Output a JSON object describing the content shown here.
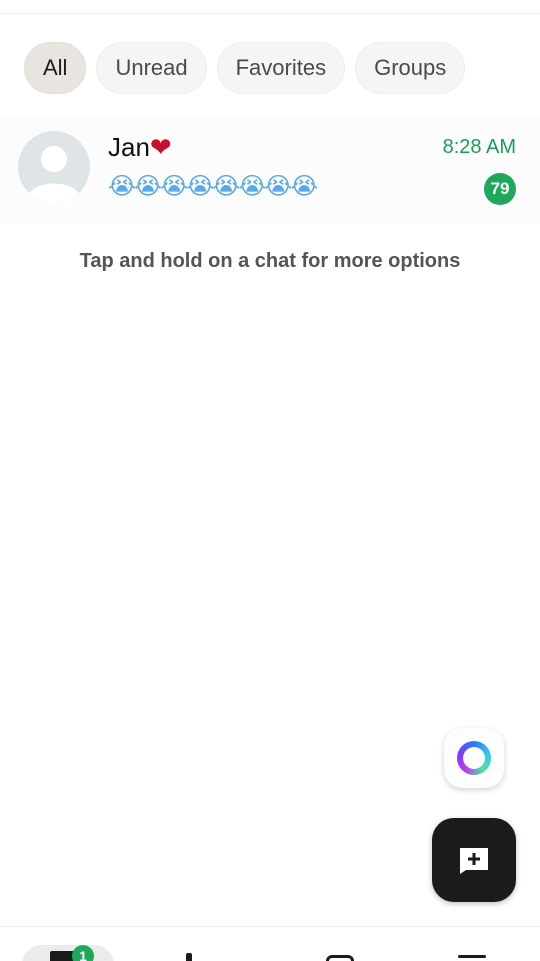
{
  "filters": [
    {
      "label": "All",
      "active": true
    },
    {
      "label": "Unread",
      "active": false
    },
    {
      "label": "Favorites",
      "active": false
    },
    {
      "label": "Groups",
      "active": false
    }
  ],
  "chat": {
    "name": "Jan",
    "name_emoji": "❤",
    "time": "8:28 AM",
    "preview": "😭😭😭😭😭😭😭😭",
    "unread_count": "79",
    "avatar_icon": "default-person-icon"
  },
  "hint": "Tap and hold on a chat for more options",
  "bottom_nav": {
    "chats_badge": "1"
  },
  "colors": {
    "accent_green": "#1fa85c",
    "time_green": "#1a9e5b",
    "fab_bg": "#1b1b1b"
  },
  "icons": {
    "ai_button": "meta-ai-ring-icon",
    "fab": "new-chat-icon"
  }
}
